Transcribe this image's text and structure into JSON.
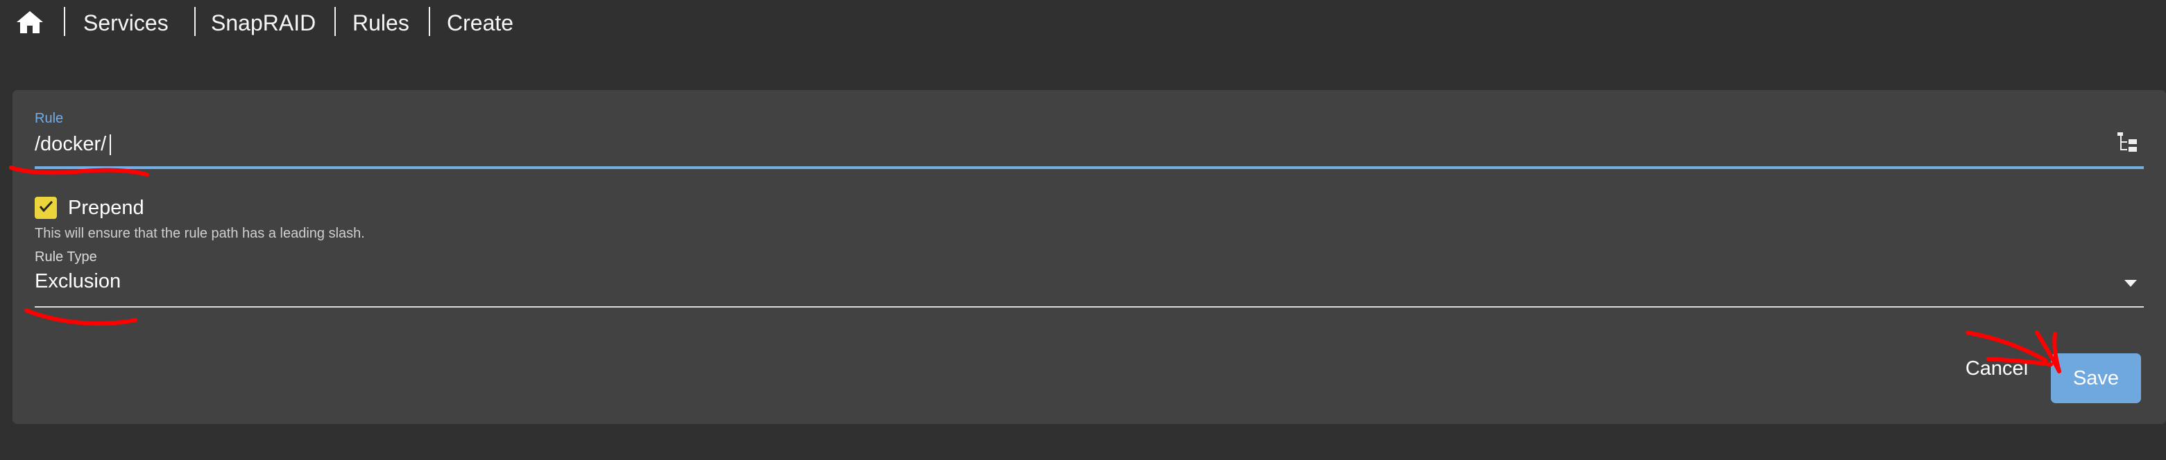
{
  "breadcrumb": {
    "home_icon": "home-icon",
    "items": [
      "Services",
      "SnapRAID",
      "Rules",
      "Create"
    ]
  },
  "form": {
    "rule": {
      "label": "Rule",
      "value": "/docker/",
      "button_icon": "folder-tree-icon"
    },
    "prepend": {
      "checked": true,
      "label": "Prepend",
      "hint": "This will ensure that the rule path has a leading slash."
    },
    "rule_type": {
      "label": "Rule Type",
      "selected": "Exclusion"
    }
  },
  "actions": {
    "cancel_label": "Cancel",
    "save_label": "Save"
  },
  "colors": {
    "background": "#303030",
    "panel": "#424242",
    "focus_accent": "#73AEE4",
    "checkbox": "#ECD53C",
    "save_button": "#6FA8DE",
    "annotation": "#FF0000"
  }
}
